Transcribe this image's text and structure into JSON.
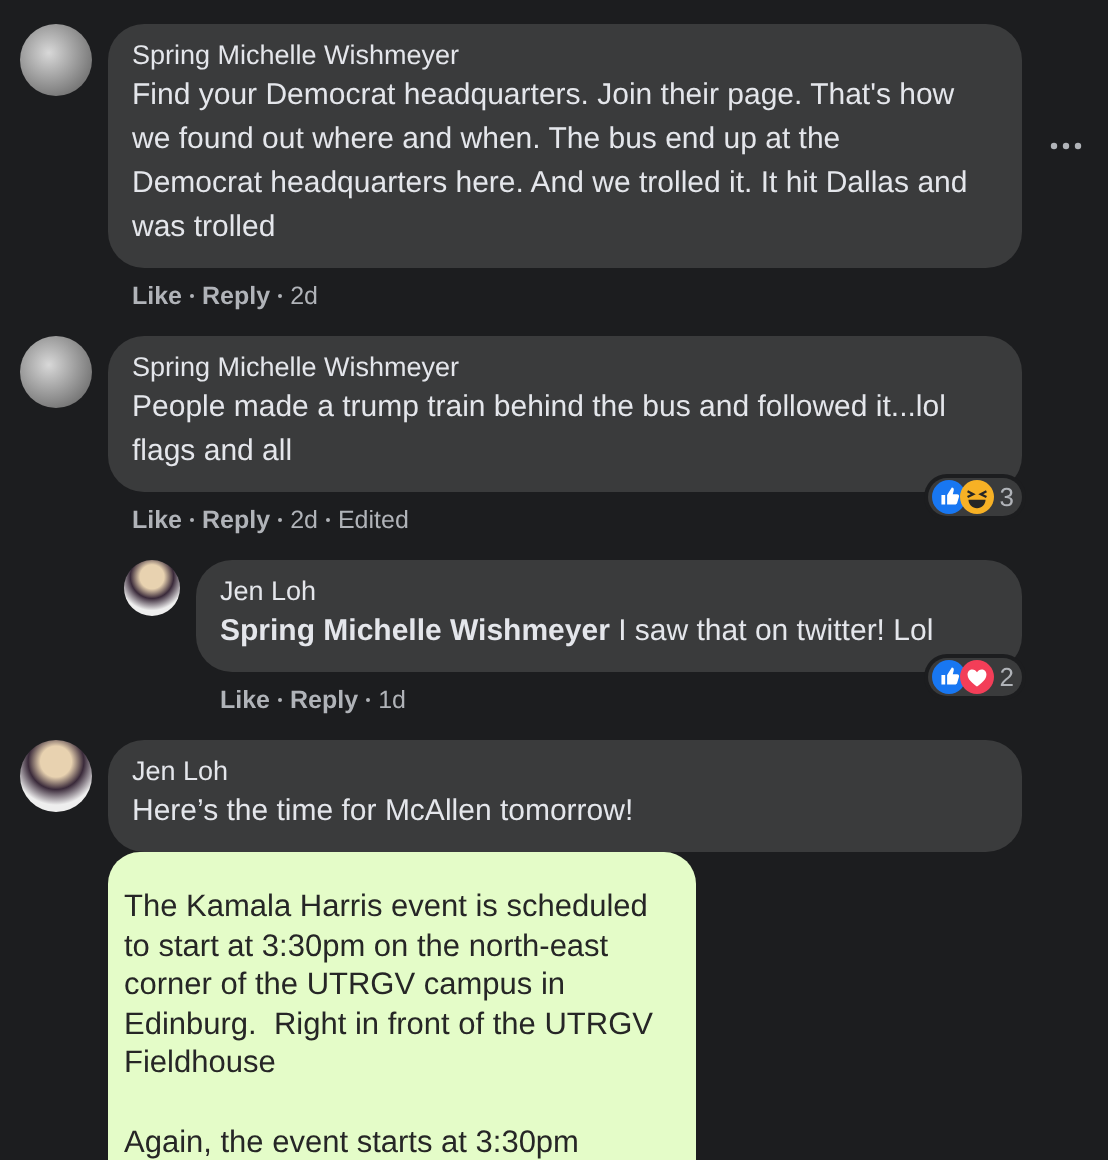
{
  "comments": [
    {
      "author": "Spring Michelle Wishmeyer",
      "text": "Find your Democrat headquarters. Join their page. That's how we found out where and when. The bus end up at the Democrat headquarters here. And we trolled it. It hit Dallas and was trolled",
      "show_menu": true,
      "actions": {
        "like": "Like",
        "reply": "Reply",
        "time": "2d"
      }
    },
    {
      "author": "Spring Michelle Wishmeyer",
      "text": "People made a trump train behind the bus and followed it...lol flags and all",
      "show_menu": false,
      "reactions": {
        "like": true,
        "haha": true,
        "count": "3"
      },
      "actions": {
        "like": "Like",
        "reply": "Reply",
        "time": "2d",
        "edited": "Edited"
      },
      "children": [
        {
          "author": "Jen Loh",
          "text": "**Spring Michelle Wishmeyer** I saw that on twitter! Lol",
          "show_menu": false,
          "reactions": {
            "like": true,
            "love": true,
            "count": "2"
          },
          "actions": {
            "like": "Like",
            "reply": "Reply",
            "time": "1d"
          }
        }
      ]
    },
    {
      "author": "Jen Loh",
      "text": "Here’s the time for McAllen tomorrow!",
      "show_menu": false,
      "attachment": {
        "text": "The Kamala Harris event is scheduled to start at 3:30pm on the north-east corner of the UTRGV campus in Edinburg.  Right in front of the UTRGV Fieldhouse\n\nAgain, the event starts at 3:30pm"
      }
    }
  ]
}
